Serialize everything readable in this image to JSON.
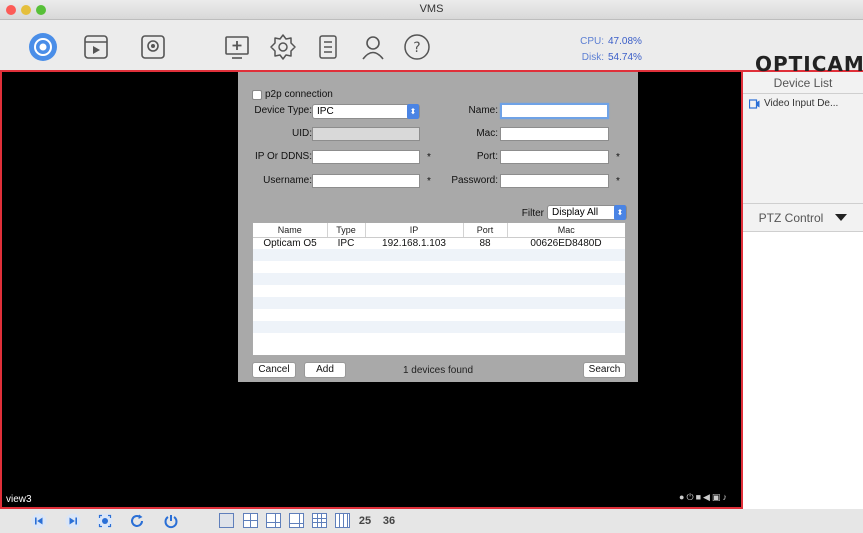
{
  "window": {
    "title": "VMS",
    "traffic_colors": {
      "close": "#fc5b57",
      "min": "#e5bf3c",
      "max": "#57c038"
    }
  },
  "stats": {
    "cpu_label": "CPU:",
    "cpu_value": "47.08%",
    "disk_label": "Disk:",
    "disk_value": "54.74%"
  },
  "brand": {
    "logo_text": "OPTICAM"
  },
  "toolbar_icons": [
    "live-view-icon",
    "playback-icon",
    "record-icon",
    "add-device-icon",
    "settings-icon",
    "log-icon",
    "user-icon",
    "help-icon"
  ],
  "colors": {
    "accent": "#e0303a",
    "blue": "#2a6fd6",
    "video_bg": "#000000",
    "dialog_bg": "#a9a9a9"
  },
  "video": {
    "view_label": "view3"
  },
  "right_panel": {
    "device_list_title": "Device List",
    "device_item": "Video Input De...",
    "ptz_title": "PTZ Control"
  },
  "bottom": {
    "grid25_label": "25",
    "grid36_label": "36"
  },
  "dialog": {
    "p2p_label": "p2p connection",
    "device_type_label": "Device Type:",
    "device_type_value": "IPC",
    "name_label": "Name:",
    "uid_label": "UID:",
    "mac_label": "Mac:",
    "ip_label": "IP Or DDNS:",
    "port_label": "Port:",
    "username_label": "Username:",
    "password_label": "Password:",
    "required_mark": "*",
    "filter_label": "Filter",
    "filter_value": "Display All",
    "table": {
      "columns": [
        "Name",
        "Type",
        "IP",
        "Port",
        "Mac"
      ],
      "rows": [
        [
          "Opticam O5",
          "IPC",
          "192.168.1.103",
          "88",
          "00626ED8480D"
        ]
      ]
    },
    "cancel_label": "Cancel",
    "add_label": "Add",
    "found_text": "1 devices found",
    "search_label": "Search"
  }
}
